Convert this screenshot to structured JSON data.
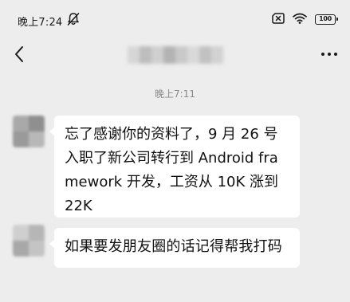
{
  "status_bar": {
    "time": "晚上7:24",
    "battery_level": "100",
    "icons": [
      "mute-icon",
      "sim-off-icon",
      "wifi-icon",
      "battery-icon"
    ]
  },
  "nav": {
    "back_icon": "chevron-left-icon",
    "more_icon": "more-horizontal-icon"
  },
  "chat": {
    "timestamp": "晚上7:11",
    "messages": [
      {
        "text": "忘了感谢你的资料了，9 月 26 号入职了新公司转行到 Android framework 开发，工资从 10K 涨到 22K"
      },
      {
        "text": "如果要发朋友圈的话记得帮我打码"
      }
    ]
  },
  "colors": {
    "background": "#ededed",
    "bubble": "#ffffff",
    "text": "#111111",
    "timestamp": "#8a8a8a"
  }
}
